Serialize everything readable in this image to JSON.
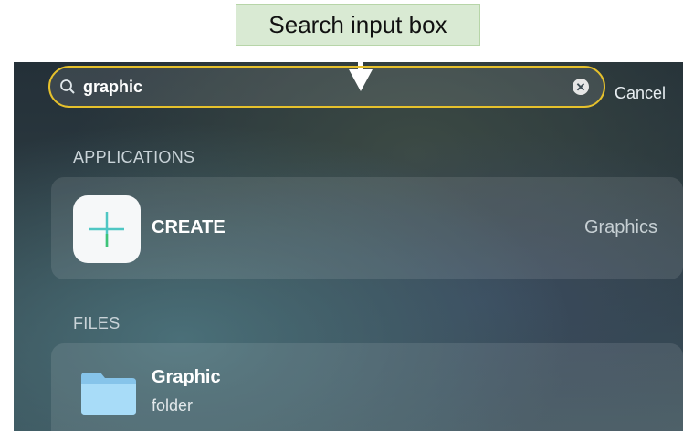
{
  "annotation": {
    "label": "Search input box"
  },
  "search": {
    "query": "graphic",
    "cancel_label": "Cancel"
  },
  "sections": {
    "applications": {
      "title": "APPLICATIONS",
      "items": [
        {
          "name": "CREATE",
          "category": "Graphics",
          "icon": "create-app-icon"
        }
      ]
    },
    "files": {
      "title": "FILES",
      "items": [
        {
          "name": "Graphic",
          "kind": "folder",
          "icon": "folder-icon"
        }
      ]
    }
  },
  "colors": {
    "highlight": "#e6c12c",
    "callout_bg": "#d9ead3",
    "folder": "#9fd3f2",
    "create_plus": "#4fc7c4"
  }
}
